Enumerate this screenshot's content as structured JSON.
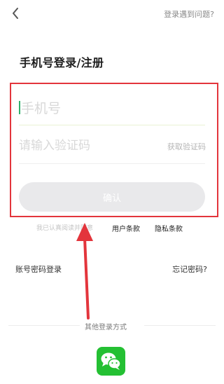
{
  "header": {
    "back_icon": "chevron-left-icon",
    "help_link": "登录遇到问题?"
  },
  "title": "手机号登录/注册",
  "form": {
    "phone_placeholder": "手机号",
    "code_placeholder": "请输入验证码",
    "get_code_label": "获取验证码",
    "confirm_label": "确认"
  },
  "agreement": {
    "prefix": "我已认真阅读并同意",
    "terms_label": "用户条款",
    "privacy_label": "隐私条款"
  },
  "links": {
    "password_login": "账号密码登录",
    "forgot_password": "忘记密码?"
  },
  "other_login": {
    "label": "其他登录方式",
    "wechat_icon": "wechat-icon",
    "wechat_color": "#24c033"
  },
  "annotation": {
    "highlight_color": "#e3353c"
  }
}
